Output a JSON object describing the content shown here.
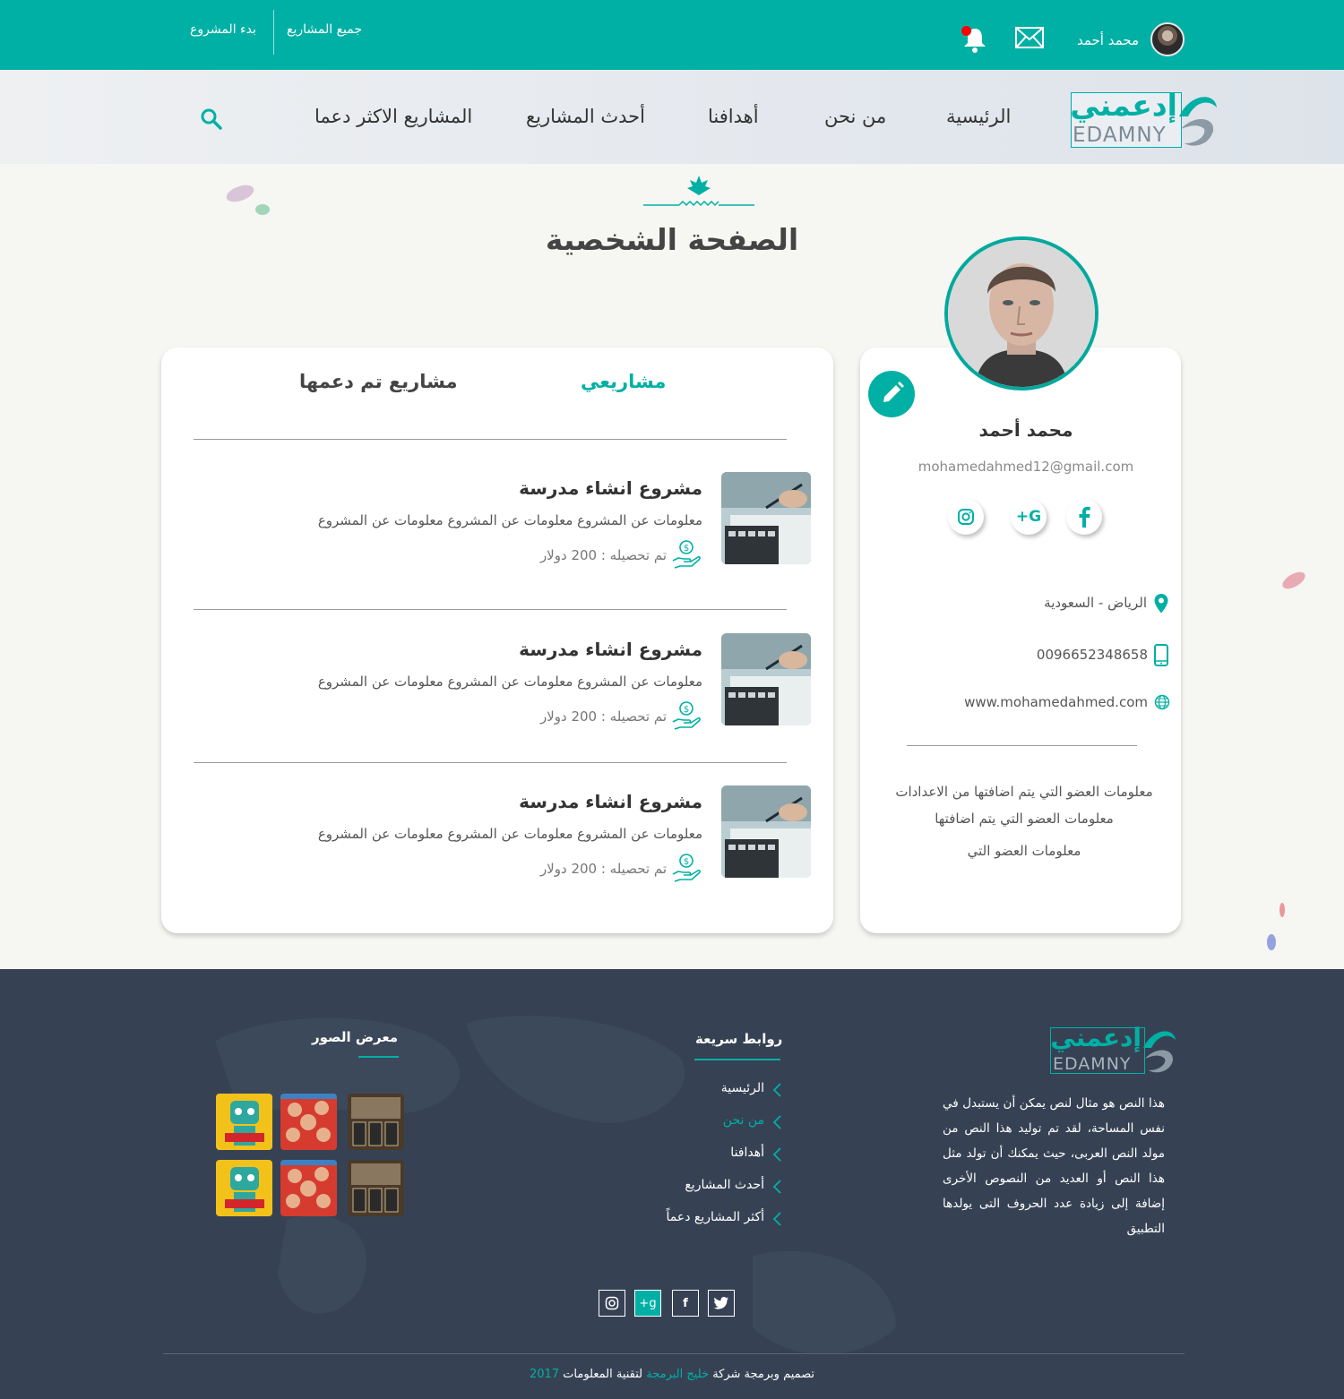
{
  "topbar": {
    "user_name": "محمد أحمد",
    "link_all_projects": "جميع المشاريع",
    "link_start_project": "بدء المشروع",
    "notification_dot": true
  },
  "nav": {
    "logo_ar": "إدعمني",
    "logo_en": "EDAMNY",
    "items": [
      "الرئيسية",
      "من نحن",
      "أهدافنا",
      "أحدث المشاريع",
      "المشاريع الاكثر دعما"
    ]
  },
  "page": {
    "title": "الصفحة الشخصية"
  },
  "profile": {
    "name": "محمد أحمد",
    "email": "mohamedahmed12@gmail.com",
    "location": "الرياض - السعودية",
    "phone": "0096652348658",
    "website": "www.mohamedahmed.com",
    "bio_lines": [
      "معلومات العضو التي يتم اضافتها من الاعدادات",
      "معلومات العضو التي يتم اضافتها",
      "معلومات العضو التي"
    ],
    "socials": [
      "facebook-icon",
      "google-plus-icon",
      "instagram-icon"
    ]
  },
  "tabs": {
    "mine": "مشاريعي",
    "supported": "مشاريع تم دعمها",
    "active": "mine"
  },
  "projects": [
    {
      "title": "مشروع انشاء مدرسة",
      "desc": "معلومات عن المشروع معلومات عن المشروع معلومات عن المشروع",
      "raised": "تم تحصيله : 200 دولار"
    },
    {
      "title": "مشروع انشاء مدرسة",
      "desc": "معلومات عن المشروع معلومات عن المشروع معلومات عن المشروع",
      "raised": "تم تحصيله : 200 دولار"
    },
    {
      "title": "مشروع انشاء مدرسة",
      "desc": "معلومات عن المشروع معلومات عن المشروع معلومات عن المشروع",
      "raised": "تم تحصيله : 200 دولار"
    }
  ],
  "footer": {
    "logo_ar": "إدعمني",
    "logo_en": "EDAMNY",
    "about": "هذا النص هو مثال لنص يمكن أن يستبدل في نفس المساحة، لقد تم توليد هذا النص من مولد النص العربى، حيث يمكنك أن تولد مثل هذا النص أو العديد من النصوص الأخرى إضافة إلى زيادة عدد الحروف التى يولدها التطبيق",
    "quick_links_title": "روابط سريعة",
    "quick_links": [
      "الرئيسية",
      "من نحن",
      "أهدافنا",
      "أحدث المشاريع",
      "أكثر المشاريع دعماً"
    ],
    "quick_links_active": 1,
    "gallery_title": "معرض الصور",
    "socials": [
      "instagram-icon",
      "google-plus-icon",
      "facebook-icon",
      "twitter-icon"
    ],
    "copyright_pre": "تصميم وبرمجة شركة",
    "copyright_company": "خليج البرمجة",
    "copyright_mid": "لتقنية المعلومات",
    "copyright_year": "2017"
  },
  "colors": {
    "accent": "#00b0a5",
    "footer_bg": "#364254",
    "notification": "#ff0000"
  }
}
